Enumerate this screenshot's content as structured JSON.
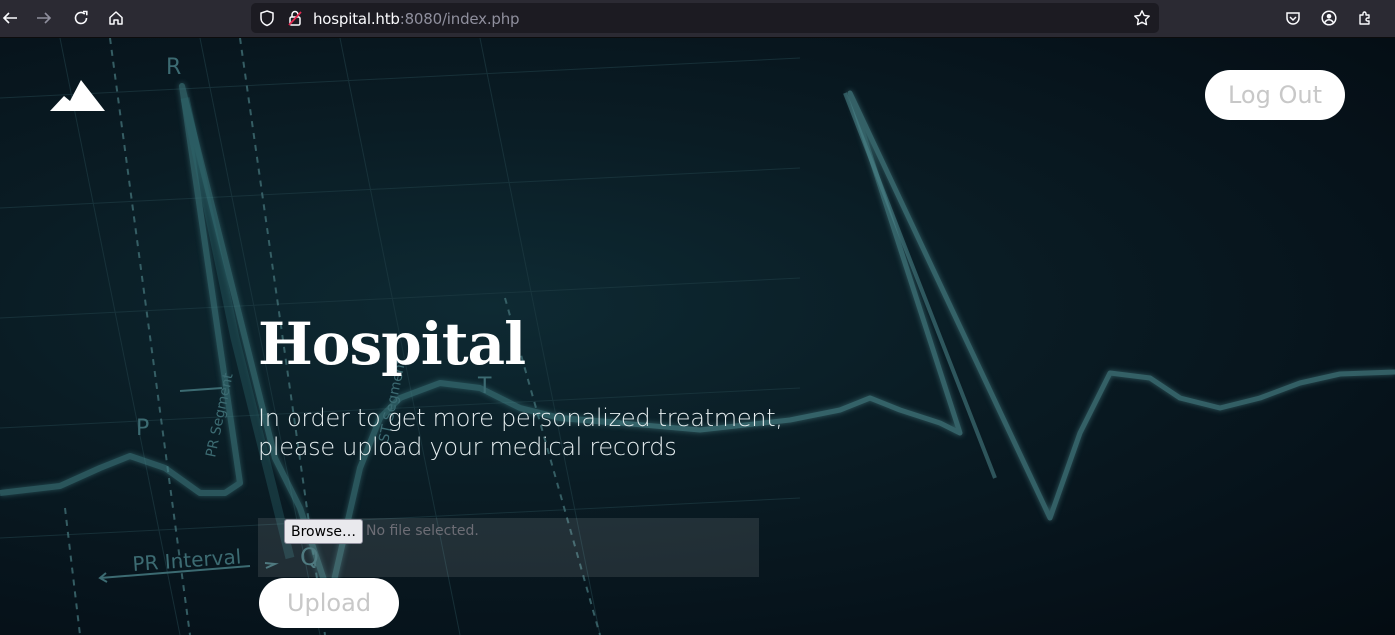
{
  "browser": {
    "url_host": "hospital.htb",
    "url_rest": ":8080/index.php"
  },
  "page": {
    "logout_label": "Log Out",
    "title": "Hospital",
    "subtitle_line1": "In order to get more personalized treatment,",
    "subtitle_line2": "please upload your medical records",
    "browse_label": "Browse…",
    "file_status": "No file selected.",
    "upload_label": "Upload"
  },
  "ecg_labels": {
    "r": "R",
    "t": "T",
    "p": "P",
    "q": "Q",
    "pr_segment": "PR Segment",
    "st_segment": "ST Segment",
    "pr_interval": "PR Interval"
  },
  "colors": {
    "toolbar": "#2b2a33",
    "page_bg": "#06121a",
    "ecg_line": "#4f8a8e"
  },
  "icons": [
    "back-arrow-icon",
    "forward-arrow-icon",
    "reload-icon",
    "home-icon",
    "shield-icon",
    "lock-icon",
    "star-icon",
    "pocket-icon",
    "account-icon",
    "extensions-icon",
    "mountain-logo-icon"
  ]
}
